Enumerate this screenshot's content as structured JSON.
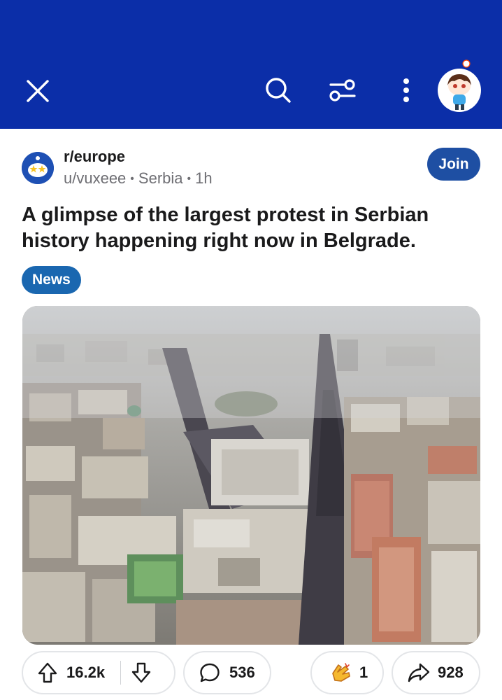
{
  "colors": {
    "brand": "#0b2ea8",
    "join": "#1e4fa3",
    "flair": "#1a67b0"
  },
  "header": {
    "icons": [
      "close-icon",
      "search-icon",
      "filter-icon",
      "more-vertical-icon",
      "user-avatar"
    ]
  },
  "post": {
    "subreddit": "r/europe",
    "author": "u/vuxeee",
    "user_flair": "Serbia",
    "age": "1h",
    "join_label": "Join",
    "title": "A glimpse of the largest protest in Serbian history happening right now in Belgrade.",
    "post_flair": "News",
    "image_icon": "aerial-city-protest-photo"
  },
  "actions": {
    "upvotes": "16.2k",
    "comments": "536",
    "awards": "1",
    "shares": "928"
  }
}
